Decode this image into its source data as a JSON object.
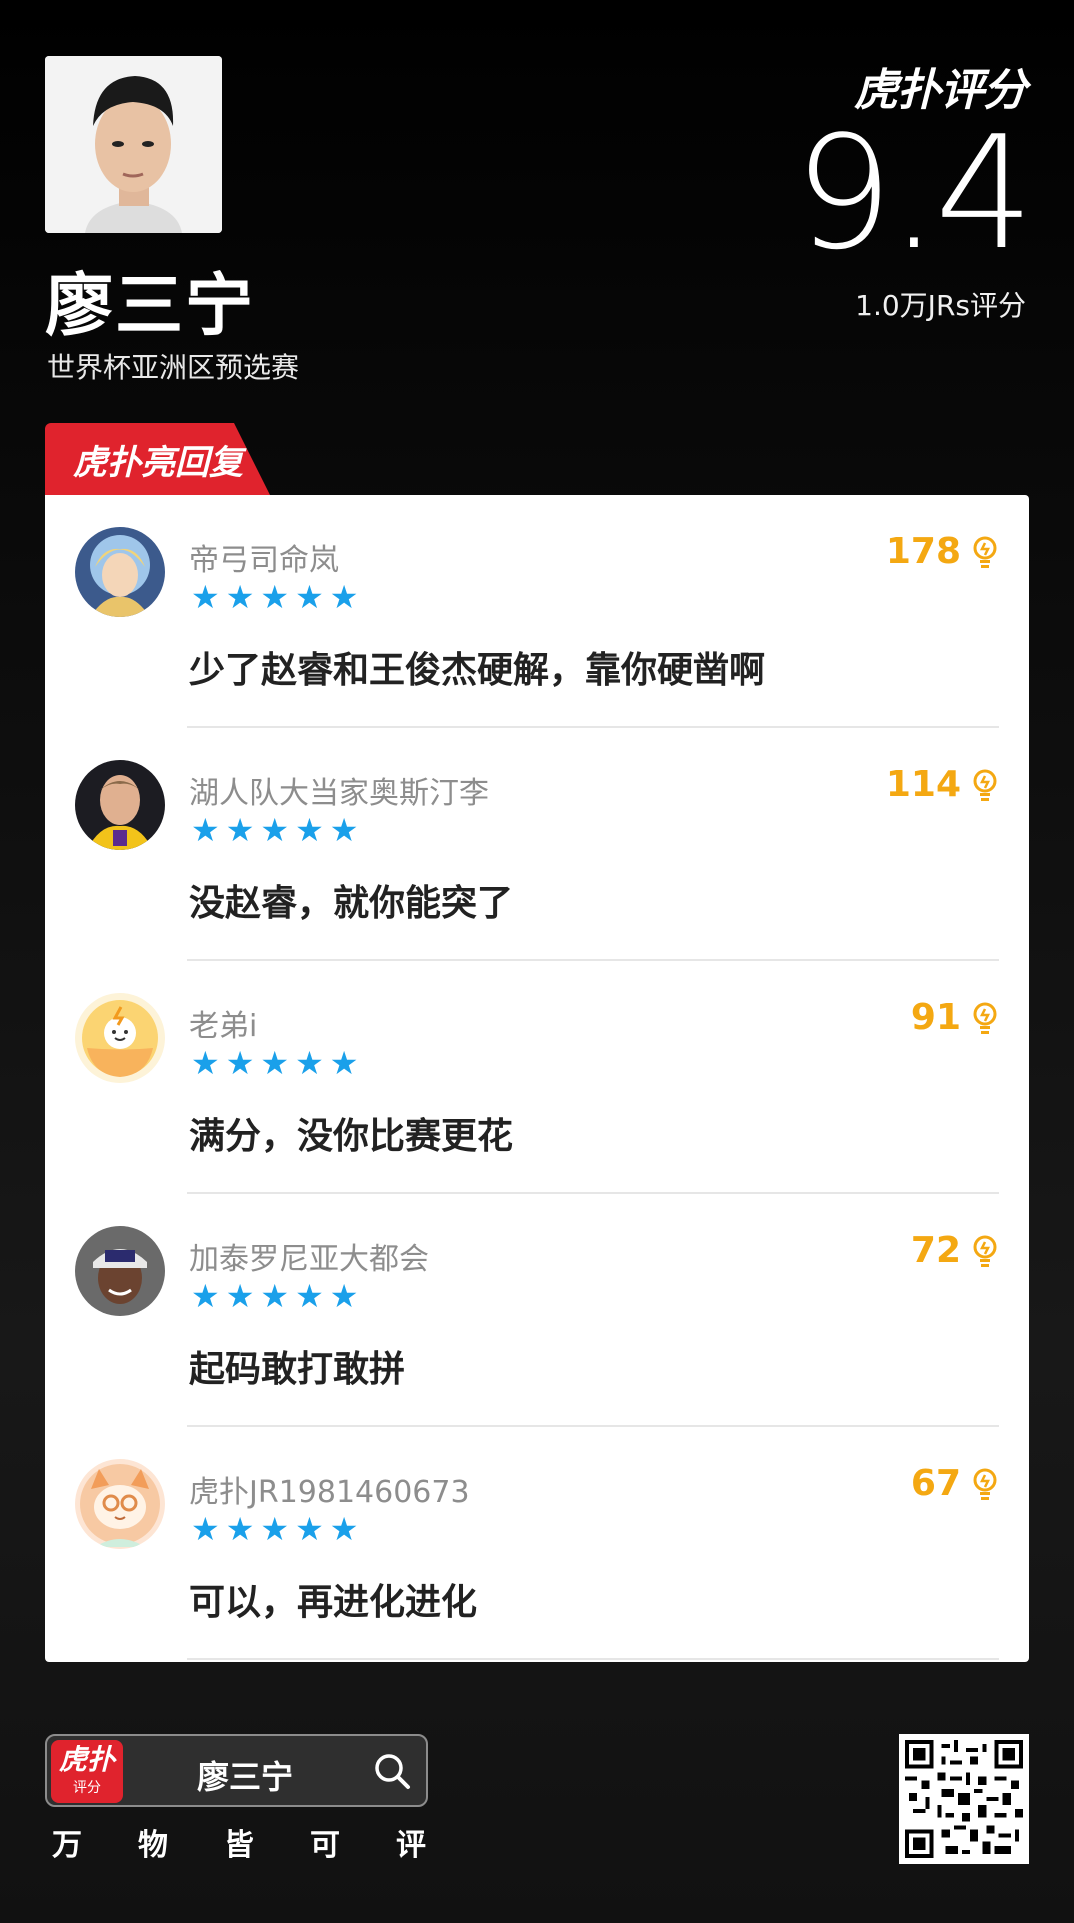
{
  "player": {
    "name": "廖三宁",
    "event": "世界杯亚洲区预选赛"
  },
  "brand": {
    "logo": "虎扑评分"
  },
  "rating": {
    "score": "9.4",
    "count": "1.0万JRs评分"
  },
  "section": {
    "label": "虎扑亮回复"
  },
  "comments": [
    {
      "user": "帝弓司命岚",
      "text": "少了赵睿和王俊杰硬解，靠你硬凿啊",
      "likes": "178",
      "stars": 5
    },
    {
      "user": "湖人队大当家奥斯汀李",
      "text": "没赵睿，就你能突了",
      "likes": "114",
      "stars": 5
    },
    {
      "user": "老弟i",
      "text": "满分，没你比赛更花",
      "likes": "91",
      "stars": 5
    },
    {
      "user": "加泰罗尼亚大都会",
      "text": "起码敢打敢拼",
      "likes": "72",
      "stars": 5
    },
    {
      "user": "虎扑JR1981460673",
      "text": "可以，再进化进化",
      "likes": "67",
      "stars": 5
    }
  ],
  "footer": {
    "logo_top": "虎扑",
    "logo_bottom": "评分",
    "search_text": "廖三宁",
    "slogan": [
      "万",
      "物",
      "皆",
      "可",
      "评"
    ]
  },
  "colors": {
    "accent_red": "#e0232d",
    "star_blue": "#1aa0ea",
    "likes_gold": "#f4a812"
  }
}
